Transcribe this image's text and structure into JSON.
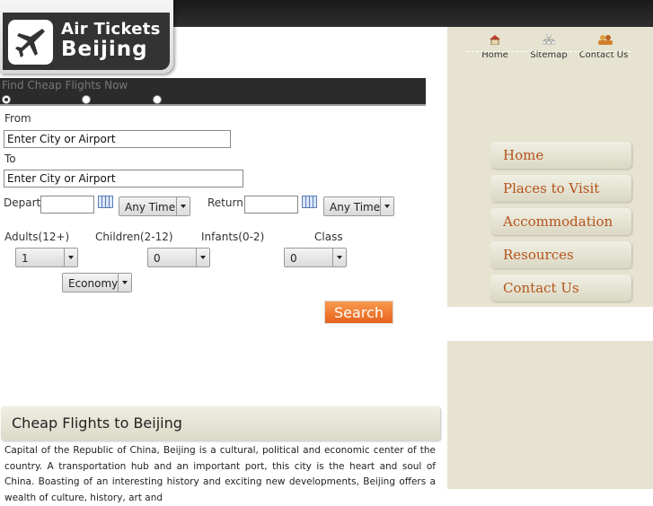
{
  "logo": {
    "line1": "Air Tickets",
    "line2": "Beijing"
  },
  "toplinks": [
    {
      "label": "Home",
      "icon": "home-icon"
    },
    {
      "label": "Sitemap",
      "icon": "sitemap-icon"
    },
    {
      "label": "Contact Us",
      "icon": "contact-icon"
    }
  ],
  "menu": [
    {
      "label": "Home"
    },
    {
      "label": "Places to Visit"
    },
    {
      "label": "Accommodation"
    },
    {
      "label": "Resources"
    },
    {
      "label": "Contact Us"
    }
  ],
  "form": {
    "strip_title": "Find Cheap Flights Now",
    "from_label": "From",
    "from_value": "Enter City or Airport",
    "to_label": "To",
    "to_value": "Enter City or Airport",
    "depart_label": "Depart:",
    "depart_time": "Any Time",
    "return_label": "Return:",
    "return_time": "Any Time",
    "adults_label": "Adults(12+)",
    "children_label": "Children(2-12)",
    "infants_label": "Infants(0-2)",
    "class_label": "Class",
    "adults_value": "1",
    "children_value": "0",
    "infants_value": "0",
    "class_value": "Economy",
    "search_label": "Search"
  },
  "section": {
    "title": "Cheap Flights to Beijing",
    "body": "Capital of the Republic of China, Beijing is a cultural, political and economic center of the country. A transportation hub and an important port, this city is the heart and soul of China. Boasting of an interesting history and exciting new developments, Beijing offers a wealth of culture, history, art and"
  },
  "colors": {
    "accent": "#b5531b",
    "search_button": "#e8611a",
    "sidebar_bg": "#e6e4d0",
    "topbar": "#1a1a1a"
  }
}
